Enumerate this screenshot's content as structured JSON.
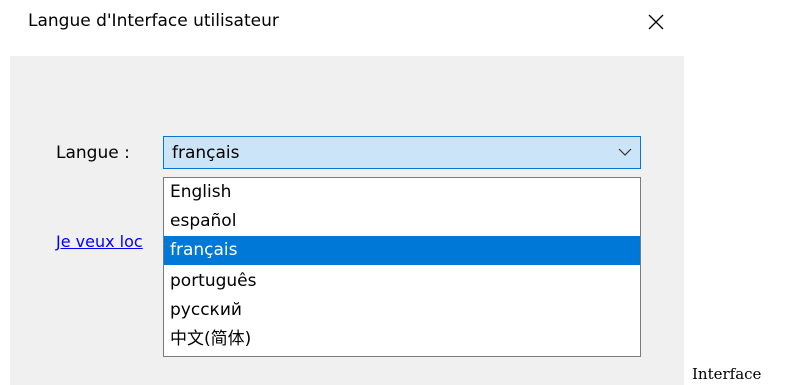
{
  "window": {
    "title": "Langue d'Interface utilisateur"
  },
  "form": {
    "language_label": "Langue :",
    "language_selected": "français",
    "link_text": "Je veux loc"
  },
  "dropdown": {
    "options": [
      {
        "label": "English",
        "selected": false
      },
      {
        "label": "español",
        "selected": false
      },
      {
        "label": "français",
        "selected": true
      },
      {
        "label": "português",
        "selected": false
      },
      {
        "label": "русский",
        "selected": false
      },
      {
        "label": "中文(简体)",
        "selected": false
      }
    ]
  },
  "background": {
    "side_text": "Interface"
  },
  "colors": {
    "accent": "#0078d7",
    "combo_bg": "#cce4f7",
    "link": "#0000ff",
    "panel_bg": "#f0f0f0"
  },
  "icons": {
    "close": "close-icon",
    "dropdown": "chevron-down-icon"
  }
}
